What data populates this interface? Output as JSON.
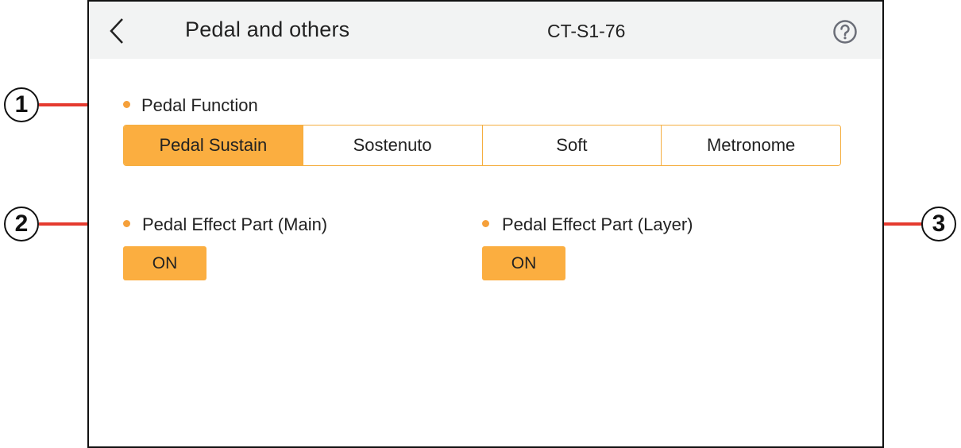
{
  "header": {
    "back_icon": "chevron-left-icon",
    "title": "Pedal and others",
    "model": "CT-S1-76",
    "help_icon": "question-circle-icon"
  },
  "pedal_function": {
    "label": "Pedal Function",
    "options": [
      {
        "label": "Pedal Sustain",
        "selected": true
      },
      {
        "label": "Sostenuto",
        "selected": false
      },
      {
        "label": "Soft",
        "selected": false
      },
      {
        "label": "Metronome",
        "selected": false
      }
    ]
  },
  "pedal_effect_main": {
    "label": "Pedal Effect Part (Main)",
    "value": "ON"
  },
  "pedal_effect_layer": {
    "label": "Pedal Effect Part (Layer)",
    "value": "ON"
  },
  "callouts": [
    "1",
    "2",
    "3"
  ],
  "colors": {
    "accent": "#fbae40",
    "header_bg": "#f2f3f3",
    "callout_line": "#e53a2f",
    "bullet": "#f5a03a"
  }
}
